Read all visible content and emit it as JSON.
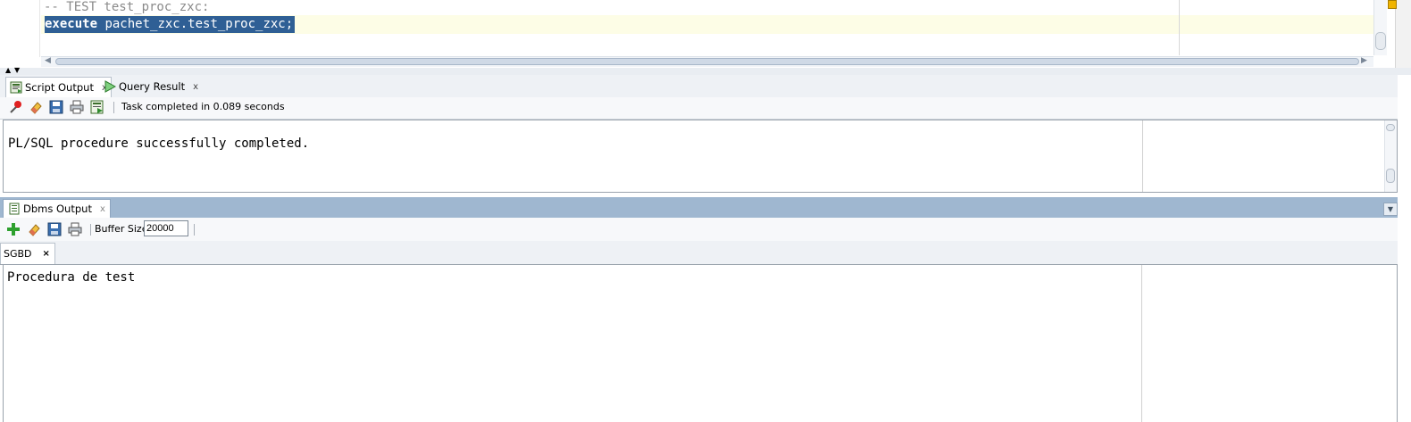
{
  "editor": {
    "line1": "-- TEST test_proc_zxc:",
    "line2_keyword": "execute",
    "line2_rest": " pachet_zxc.test_proc_zxc;"
  },
  "script_panel": {
    "tabs": [
      {
        "label": "Script Output",
        "close": "x"
      },
      {
        "label": "Query Result",
        "close": "x"
      }
    ],
    "toolbar_icons": [
      "pin-icon",
      "eraser-icon",
      "save-icon",
      "print-icon",
      "run-script-icon"
    ],
    "status": "Task completed in 0.089 seconds",
    "output": "PL/SQL procedure successfully completed."
  },
  "dbms_panel": {
    "tab_label": "Dbms Output",
    "tab_close": "x",
    "toolbar_icons": [
      "add-connection-icon",
      "eraser-icon",
      "save-icon",
      "print-icon"
    ],
    "buffer_label": "Buffer Size:",
    "buffer_value": "20000",
    "connection_tab": "SGBD",
    "connection_close": "×",
    "output": "Procedura de test"
  },
  "colors": {
    "selection": "#2f5f95",
    "current_line": "#fdfde6",
    "dbms_header": "#9fb7d0"
  }
}
